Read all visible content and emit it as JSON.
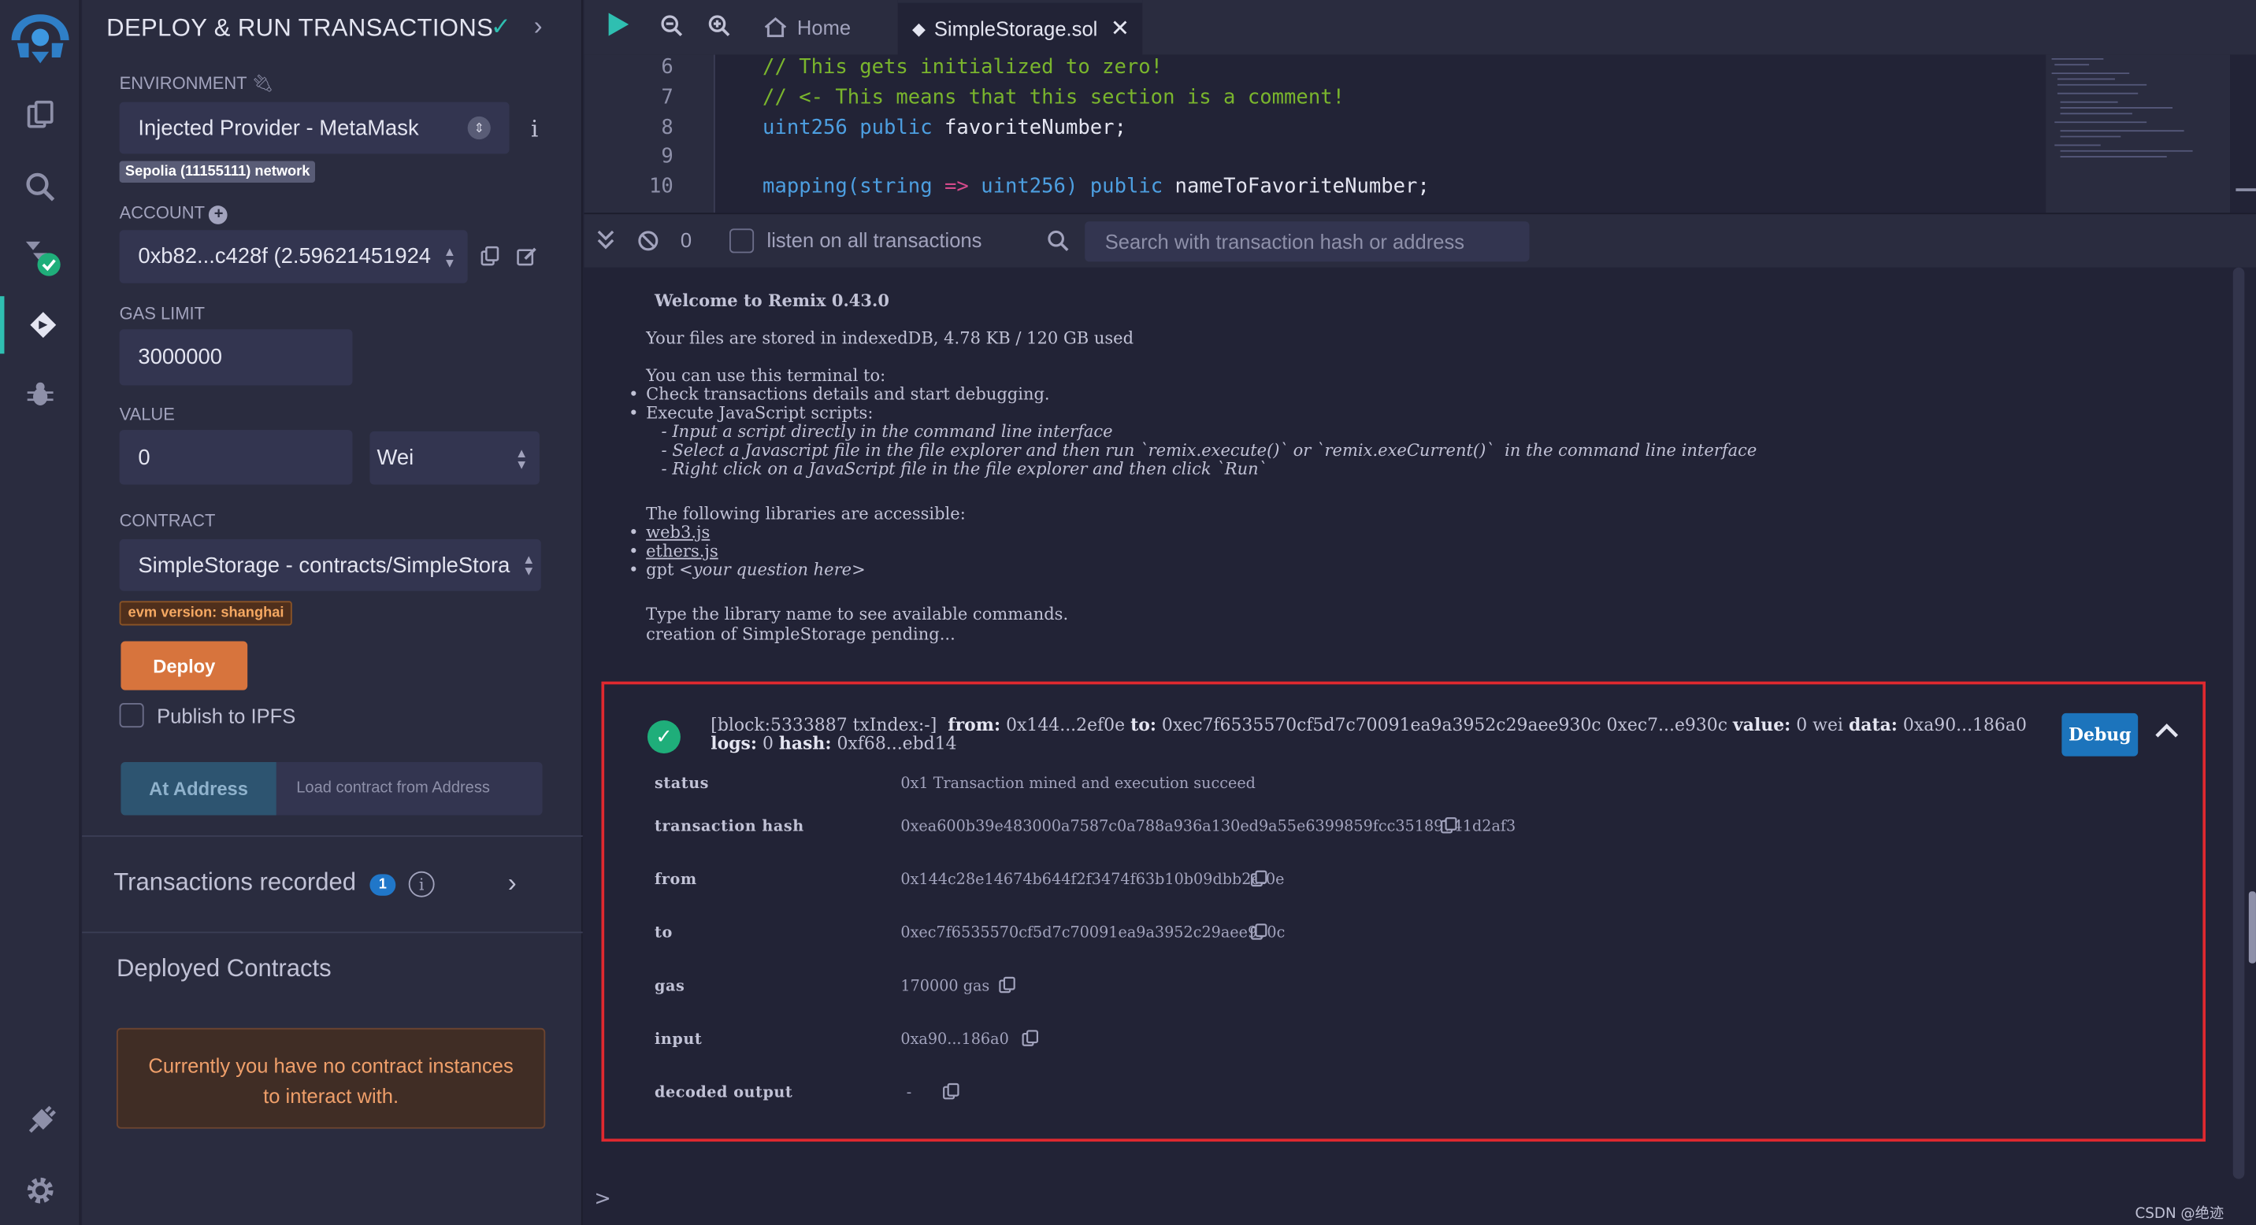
{
  "side": {
    "title": "DEPLOY & RUN TRANSACTIONS",
    "environment_label": "ENVIRONMENT",
    "environment_value": "Injected Provider - MetaMask",
    "network_badge": "Sepolia (11155111) network",
    "account_label": "ACCOUNT",
    "account_value": "0xb82...c428f (2.59621451924",
    "gas_limit_label": "GAS LIMIT",
    "gas_limit_value": "3000000",
    "value_label": "VALUE",
    "value_amount": "0",
    "value_unit": "Wei",
    "contract_label": "CONTRACT",
    "contract_value": "SimpleStorage - contracts/SimpleStora",
    "evm_badge": "evm version: shanghai",
    "deploy_label": "Deploy",
    "publish_label": "Publish to IPFS",
    "at_address_label": "At Address",
    "at_address_placeholder": "Load contract from Address",
    "transactions_recorded": "Transactions recorded",
    "transactions_count": "1",
    "deployed_contracts": "Deployed Contracts",
    "no_instances": "Currently you have no contract instances to interact with."
  },
  "tabs": {
    "home": "Home",
    "file": "SimpleStorage.sol"
  },
  "editor": {
    "line_numbers": [
      "6",
      "7",
      "8",
      "9",
      "10"
    ],
    "line6": "// This gets initialized to zero!",
    "line7": "// <- This means that this section is a comment!",
    "line8_type": "uint256",
    "line8_kw": "public",
    "line8_rest": "favoriteNumber;",
    "line10_fn": "mapping(",
    "line10_t1": "string",
    "line10_arrow": " => ",
    "line10_t2": "uint256",
    "line10_close": ") ",
    "line10_kw": "public",
    "line10_rest": " nameToFavoriteNumber;"
  },
  "terminal": {
    "pending_count": "0",
    "listen_label": "listen on all transactions",
    "search_placeholder": "Search with transaction hash or address",
    "welcome": "Welcome to Remix 0.43.0",
    "files_stored": "Your files are stored in indexedDB, 4.78 KB / 120 GB used",
    "can_use": "You can use this terminal to:",
    "b1": "Check transactions details and start debugging.",
    "b2": "Execute JavaScript scripts:",
    "s1": " - Input a script directly in the command line interface",
    "s2": " - Select a Javascript file in the file explorer and then run `remix.execute()` or `remix.exeCurrent()`  in the command line interface",
    "s3": " - Right click on a JavaScript file in the file explorer and then click `Run`",
    "libs": "The following libraries are accessible:",
    "lib1": "web3.js",
    "lib2": "ethers.js",
    "lib3_a": "gpt ",
    "lib3_b": "<your question here>",
    "type_lib": "Type the library name to see available commands.",
    "creation": "creation of SimpleStorage pending...",
    "prompt": ">"
  },
  "tx": {
    "head_a": "[block:5333887 txIndex:-]",
    "from_lbl": "from:",
    "from_short": "0x144...2ef0e",
    "to_lbl": "to:",
    "to_long": "0xec7f6535570cf5d7c70091ea9a3952c29aee930c 0xec7...e930c",
    "value_lbl": "value:",
    "value_val": "0 wei",
    "data_lbl": "data:",
    "data_val": "0xa90...186a0",
    "logs_lbl": "logs:",
    "logs_val": "0",
    "hash_lbl": "hash:",
    "hash_val": "0xf68...ebd14",
    "debug_label": "Debug",
    "rows": [
      {
        "key": "status",
        "value": "0x1 Transaction mined and execution succeed"
      },
      {
        "key": "transaction hash",
        "value": "0xea600b39e483000a7587c0a788a936a130ed9a55e6399859fcc35189741d2af3"
      },
      {
        "key": "from",
        "value": "0x144c28e14674b644f2f3474f63b10b09dbb2ef0e"
      },
      {
        "key": "to",
        "value": "0xec7f6535570cf5d7c70091ea9a3952c29aee930c"
      },
      {
        "key": "gas",
        "value": "170000 gas"
      },
      {
        "key": "input",
        "value": "0xa90...186a0"
      },
      {
        "key": "decoded output",
        "value": "-"
      }
    ]
  },
  "watermark": "CSDN @绝迹之春",
  "colors": {
    "accent": "#2fbfb1",
    "deploy": "#d7743d",
    "debug": "#1c74bc",
    "highlight_box": "#e0292f"
  }
}
